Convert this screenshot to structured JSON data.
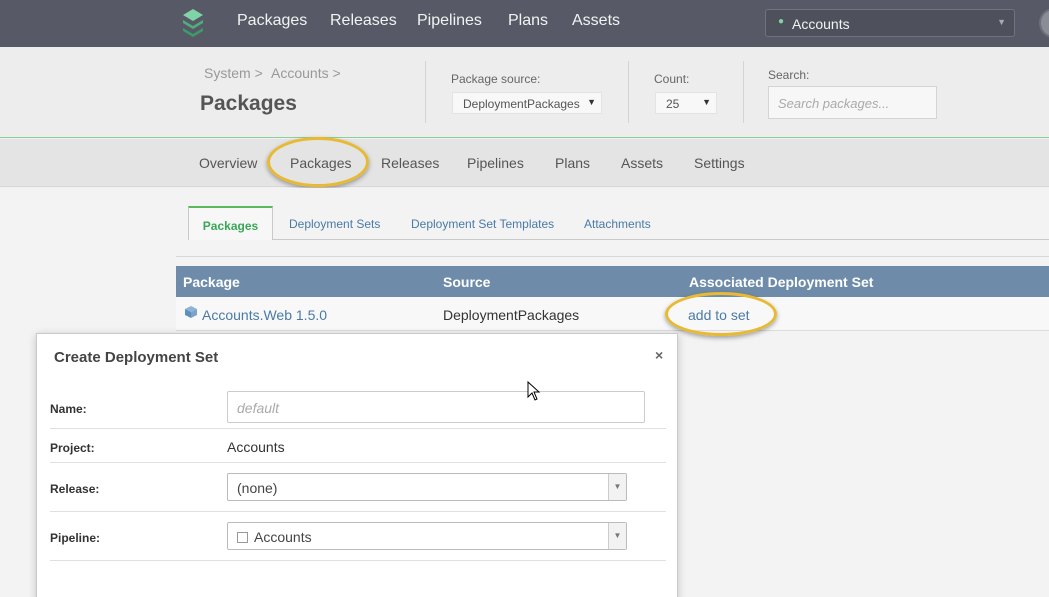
{
  "topnav": {
    "items": [
      "Packages",
      "Releases",
      "Pipelines",
      "Plans",
      "Assets"
    ],
    "project_select": "Accounts"
  },
  "breadcrumb": [
    "System >",
    "Accounts >"
  ],
  "page_title": "Packages",
  "filters": {
    "package_source_label": "Package source:",
    "package_source_value": "DeploymentPackages",
    "count_label": "Count:",
    "count_value": "25",
    "search_label": "Search:",
    "search_placeholder": "Search packages..."
  },
  "subnav": [
    "Overview",
    "Packages",
    "Releases",
    "Pipelines",
    "Plans",
    "Assets",
    "Settings"
  ],
  "tabs": [
    "Packages",
    "Deployment Sets",
    "Deployment Set Templates",
    "Attachments"
  ],
  "table": {
    "headers": [
      "Package",
      "Source",
      "Associated Deployment Set"
    ],
    "rows": [
      {
        "package": "Accounts.Web 1.5.0",
        "source": "DeploymentPackages",
        "action": "add to set"
      }
    ]
  },
  "dialog": {
    "title": "Create Deployment Set",
    "close": "×",
    "name_label": "Name:",
    "name_placeholder": "default",
    "project_label": "Project:",
    "project_value": "Accounts",
    "release_label": "Release:",
    "release_value": "(none)",
    "pipeline_label": "Pipeline:",
    "pipeline_value": "Accounts"
  },
  "icons": {
    "logo": "layers-logo-icon",
    "caret": "caret-down-icon",
    "package": "package-cube-icon",
    "close": "close-icon",
    "cursor": "mouse-pointer-icon"
  },
  "colors": {
    "topbar": "#575a66",
    "accent_green": "#5cb85c",
    "table_header": "#6e8ca9",
    "highlight_ring": "#e8b932",
    "link": "#4a7aa6"
  }
}
